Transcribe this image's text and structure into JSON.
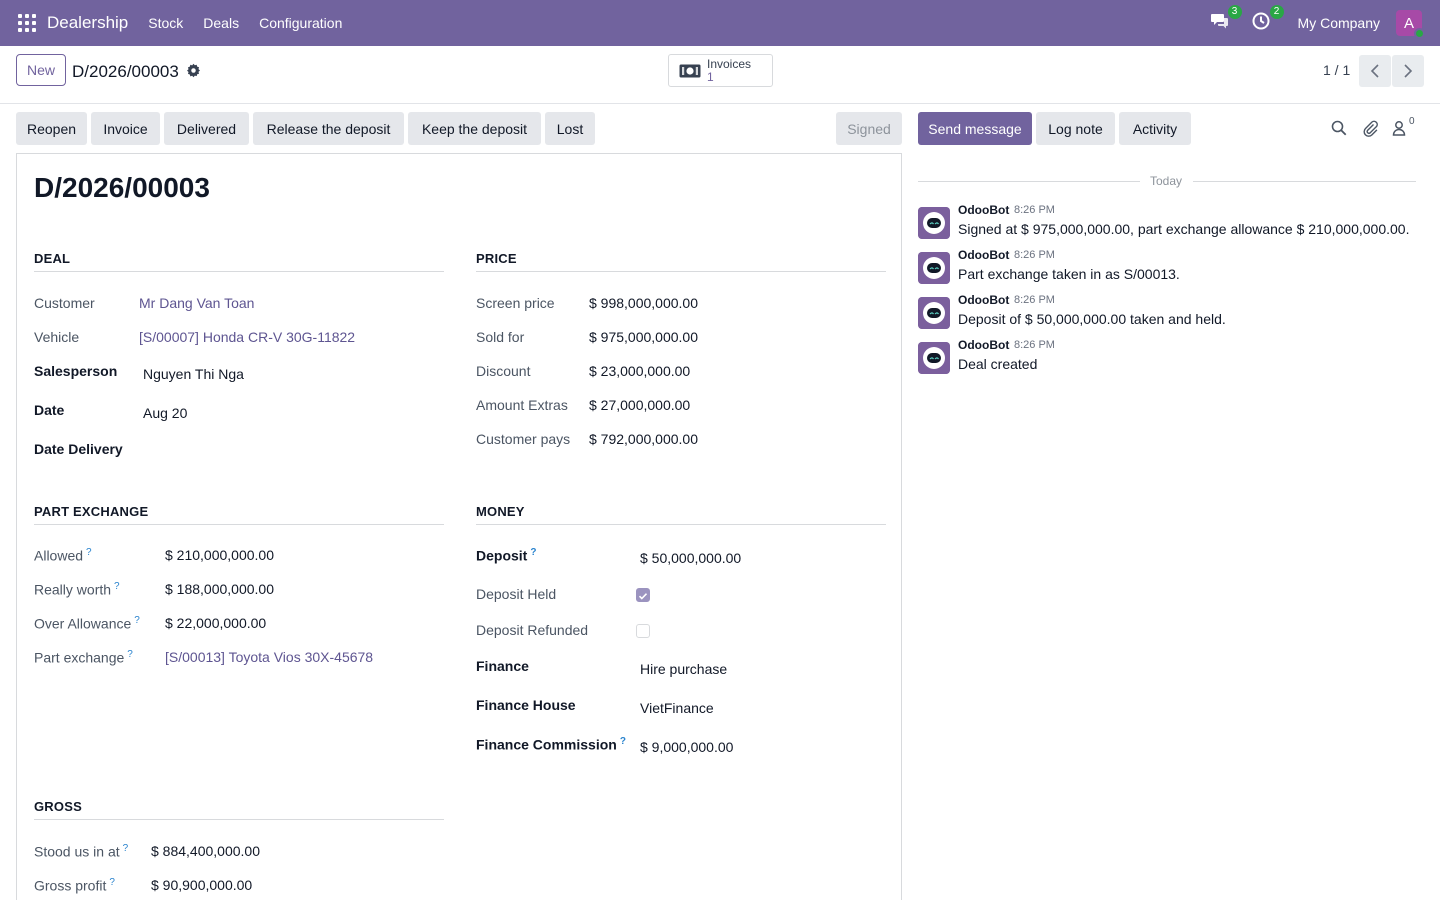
{
  "navbar": {
    "app_name": "Dealership",
    "menus": [
      "Stock",
      "Deals",
      "Configuration"
    ],
    "messages_count": "3",
    "activities_count": "2",
    "company": "My Company",
    "avatar_letter": "A",
    "bg_color": "#71639e"
  },
  "control": {
    "new_label": "New",
    "record_name": "D/2026/00003",
    "invoices_label": "Invoices",
    "invoices_count": "1",
    "pager": "1 / 1"
  },
  "statusbar": {
    "buttons": [
      "Reopen",
      "Invoice",
      "Delivered",
      "Release the deposit",
      "Keep the deposit",
      "Lost"
    ],
    "stage": "Signed"
  },
  "form": {
    "title": "D/2026/00003",
    "deal": {
      "section": "DEAL",
      "customer_label": "Customer",
      "customer": "Mr Dang Van Toan",
      "vehicle_label": "Vehicle",
      "vehicle": "[S/00007] Honda CR-V 30G-11822",
      "salesperson_label": "Salesperson",
      "salesperson": "Nguyen Thi Nga",
      "date_label": "Date",
      "date": "Aug 20",
      "date_delivery_label": "Date Delivery",
      "date_delivery": ""
    },
    "price": {
      "section": "PRICE",
      "screen_price_label": "Screen price",
      "screen_price": "$ 998,000,000.00",
      "sold_for_label": "Sold for",
      "sold_for": "$ 975,000,000.00",
      "discount_label": "Discount",
      "discount": "$ 23,000,000.00",
      "amount_extras_label": "Amount Extras",
      "amount_extras": "$ 27,000,000.00",
      "customer_pays_label": "Customer pays",
      "customer_pays": "$ 792,000,000.00"
    },
    "part_exchange": {
      "section": "PART EXCHANGE",
      "allowed_label": "Allowed",
      "allowed": "$ 210,000,000.00",
      "really_worth_label": "Really worth",
      "really_worth": "$ 188,000,000.00",
      "over_allowance_label": "Over Allowance",
      "over_allowance": "$ 22,000,000.00",
      "part_exchange_label": "Part exchange",
      "part_exchange": "[S/00013] Toyota Vios 30X-45678"
    },
    "money": {
      "section": "MONEY",
      "deposit_label": "Deposit",
      "deposit": "$ 50,000,000.00",
      "deposit_held_label": "Deposit Held",
      "deposit_held": true,
      "deposit_refunded_label": "Deposit Refunded",
      "deposit_refunded": false,
      "finance_label": "Finance",
      "finance": "Hire purchase",
      "finance_house_label": "Finance House",
      "finance_house": "VietFinance",
      "finance_commission_label": "Finance Commission",
      "finance_commission": "$ 9,000,000.00"
    },
    "gross": {
      "section": "GROSS",
      "stood_label": "Stood us in at",
      "stood": "$ 884,400,000.00",
      "gross_profit_label": "Gross profit",
      "gross_profit": "$ 90,900,000.00"
    },
    "help_mark": "?"
  },
  "chatter": {
    "send_message": "Send message",
    "log_note": "Log note",
    "activity": "Activity",
    "followers_count": "0",
    "today": "Today",
    "messages": [
      {
        "author": "OdooBot",
        "time": "8:26 PM",
        "body": "Signed at $ 975,000,000.00, part exchange allowance $ 210,000,000.00."
      },
      {
        "author": "OdooBot",
        "time": "8:26 PM",
        "body": "Part exchange taken in as S/00013."
      },
      {
        "author": "OdooBot",
        "time": "8:26 PM",
        "body": "Deposit of $ 50,000,000.00 taken and held."
      },
      {
        "author": "OdooBot",
        "time": "8:26 PM",
        "body": "Deal created"
      }
    ]
  }
}
